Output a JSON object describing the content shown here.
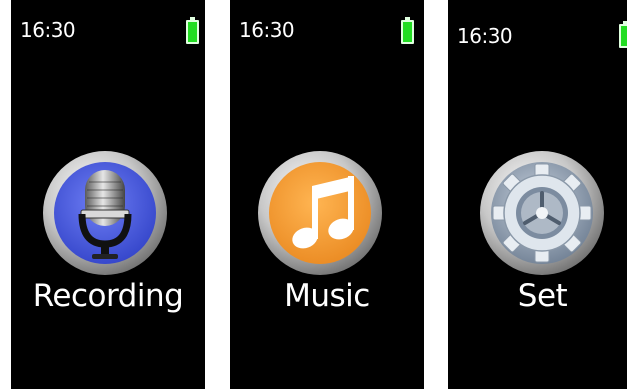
{
  "screens": [
    {
      "time": "16:30",
      "battery_icon": "battery-full-icon",
      "app_icon": "microphone-icon",
      "label": "Recording",
      "accent": "#4a5ee8"
    },
    {
      "time": "16:30",
      "battery_icon": "battery-full-icon",
      "app_icon": "music-note-icon",
      "label": "Music",
      "accent": "#f39a34"
    },
    {
      "time": "16:30",
      "battery_icon": "battery-full-icon",
      "app_icon": "gear-icon",
      "label": "Set",
      "accent": "#8fa1b6"
    }
  ]
}
